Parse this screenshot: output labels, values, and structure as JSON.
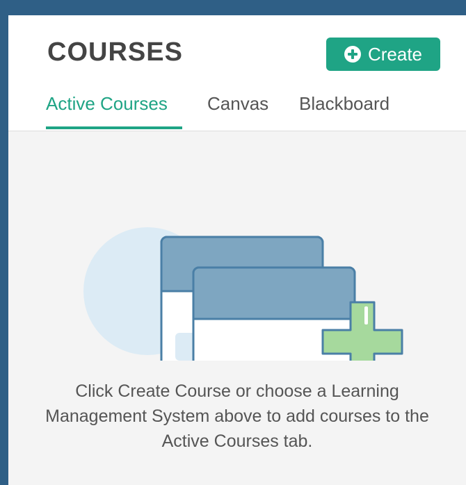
{
  "header": {
    "title": "COURSES",
    "create_button_label": "Create",
    "create_icon": "plus-circle-icon"
  },
  "tabs": [
    {
      "label": "Active Courses",
      "active": true
    },
    {
      "label": "Canvas",
      "active": false
    },
    {
      "label": "Blackboard",
      "active": false
    }
  ],
  "empty_state": {
    "illustration_icon": "course-windows-add-icon",
    "message": "Click Create Course or choose a Learning Management System above to add courses to the Active Courses tab."
  },
  "colors": {
    "accent": "#1fa485",
    "window_frame": "#2f5f86",
    "illustration_header": "#7ea6c1",
    "illustration_plus": "#a6d99d"
  }
}
